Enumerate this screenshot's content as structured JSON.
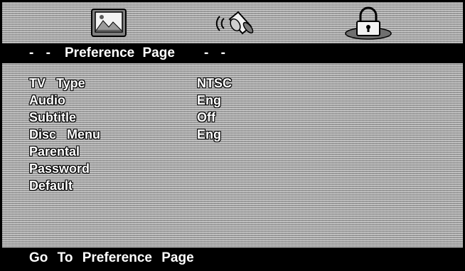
{
  "icons": [
    {
      "name": "picture-settings-icon"
    },
    {
      "name": "audio-speaker-icon"
    },
    {
      "name": "lock-preference-icon"
    }
  ],
  "header": {
    "dash_left": "- -",
    "title": "Preference Page",
    "dash_right": "- -"
  },
  "menu": {
    "items": [
      {
        "label": "TV Type",
        "value": "NTSC"
      },
      {
        "label": "Audio",
        "value": "Eng"
      },
      {
        "label": "Subtitle",
        "value": "Off"
      },
      {
        "label": "Disc Menu",
        "value": "Eng"
      },
      {
        "label": "Parental",
        "value": ""
      },
      {
        "label": "Password",
        "value": ""
      },
      {
        "label": "Default",
        "value": ""
      }
    ]
  },
  "status": {
    "text": "Go To Preference Page"
  },
  "colors": {
    "background": "#a8a8a8",
    "bar": "#000000",
    "text": "#ffffff"
  }
}
